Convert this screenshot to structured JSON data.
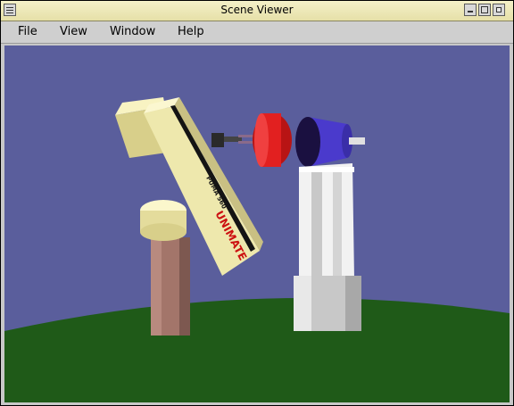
{
  "window": {
    "title": "Scene Viewer"
  },
  "menu": {
    "items": [
      "File",
      "View",
      "Window",
      "Help"
    ]
  },
  "scene": {
    "colors": {
      "sky": "#5a5e9c",
      "ground": "#1f5a18",
      "robot_body": "#eee8ad",
      "robot_stripe": "#141414",
      "pedestal": "#a3756a",
      "disc_red": "#e22020",
      "disc_blue": "#4a3acc",
      "stand": "#f2f2f2"
    },
    "robot_text": {
      "brand": "UNIMATE",
      "model": "PUMA 560"
    }
  }
}
